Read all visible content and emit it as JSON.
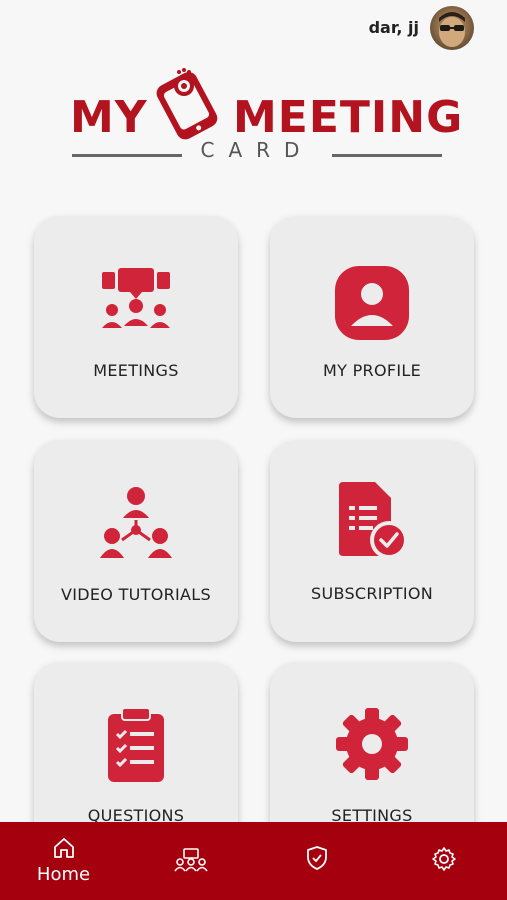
{
  "user": {
    "name": "dar, jj"
  },
  "logo": {
    "word1": "MY",
    "word2": "MEETING",
    "word3": "CARD"
  },
  "menu": {
    "meetings": "MEETINGS",
    "my_profile": "MY PROFILE",
    "video_tutorials": "VIDEO TUTORIALS",
    "subscription": "SUBSCRIPTION",
    "questions": "QUESTIONS",
    "settings": "SETTINGS"
  },
  "bottom_nav": {
    "home": "Home",
    "icons": [
      "home-icon",
      "meetings-icon",
      "shield-check-icon",
      "gear-icon"
    ]
  },
  "colors": {
    "brand": "#b3121f",
    "nav": "#a5000d",
    "icon": "#d0243a",
    "card": "#ececec"
  }
}
